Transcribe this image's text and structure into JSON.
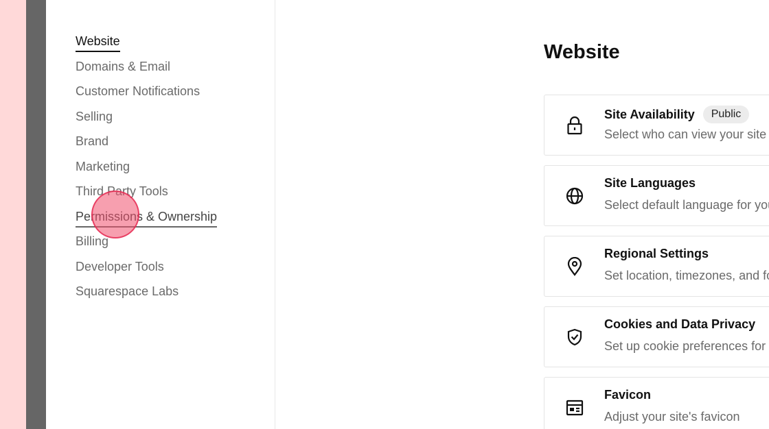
{
  "sidebar": {
    "items": [
      {
        "label": "Website",
        "state": "active"
      },
      {
        "label": "Domains & Email",
        "state": ""
      },
      {
        "label": "Customer Notifications",
        "state": ""
      },
      {
        "label": "Selling",
        "state": ""
      },
      {
        "label": "Brand",
        "state": ""
      },
      {
        "label": "Marketing",
        "state": ""
      },
      {
        "label": "Third Party Tools",
        "state": ""
      },
      {
        "label": "Permissions & Ownership",
        "state": "hover"
      },
      {
        "label": "Billing",
        "state": ""
      },
      {
        "label": "Developer Tools",
        "state": ""
      },
      {
        "label": "Squarespace Labs",
        "state": ""
      }
    ]
  },
  "main": {
    "title": "Website",
    "cards": [
      {
        "icon": "lock-icon",
        "title": "Site Availability",
        "badge": "Public",
        "description": "Select who can view your site"
      },
      {
        "icon": "globe-icon",
        "title": "Site Languages",
        "badge": "",
        "description": "Select default language for your site"
      },
      {
        "icon": "location-pin-icon",
        "title": "Regional Settings",
        "badge": "",
        "description": "Set location, timezones, and formats"
      },
      {
        "icon": "shield-check-icon",
        "title": "Cookies and Data Privacy",
        "badge": "",
        "description": "Set up cookie preferences for your site"
      },
      {
        "icon": "browser-window-icon",
        "title": "Favicon",
        "badge": "",
        "description": "Adjust your site's favicon"
      }
    ]
  },
  "colors": {
    "accent_cursor": "#f0506e",
    "text_primary": "#111111",
    "text_secondary": "#6a6a6a"
  }
}
